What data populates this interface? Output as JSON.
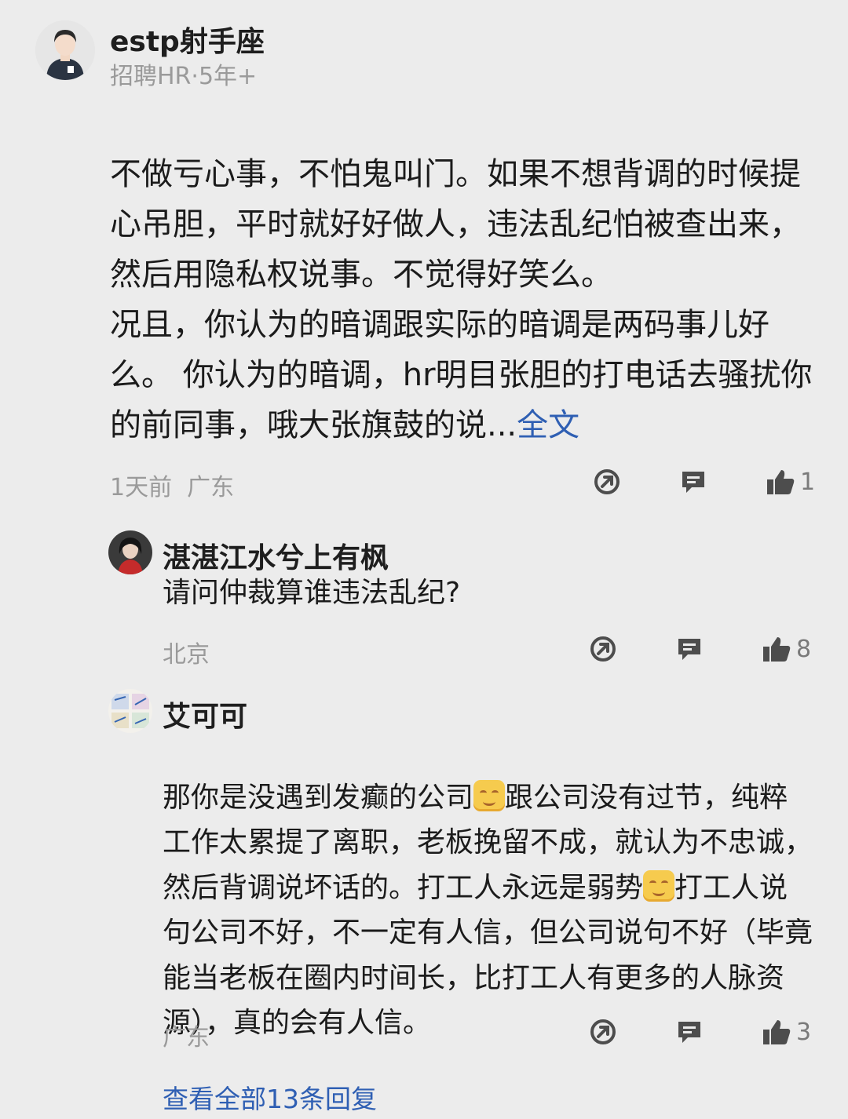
{
  "main_comment": {
    "author": "estp射手座",
    "tag": "招聘HR·5年+",
    "text": "不做亏心事，不怕鬼叫门。如果不想背调的时候提心吊胆，平时就好好做人，违法乱纪怕被查出来，然后用隐私权说事。不觉得好笑么。\n 况且，你认为的暗调跟实际的暗调是两码事儿好么。 你认为的暗调，hr明目张胆的打电话去骚扰你的前同事，哦大张旗鼓的说...",
    "more_label": "全文",
    "time": "1天前",
    "location": "广东",
    "likes": "1",
    "icons": {
      "share": "share-icon",
      "reply": "comment-icon",
      "like": "thumbs-up-icon"
    }
  },
  "replies": [
    {
      "author": "湛湛江水兮上有枫",
      "text": "请问仲裁算谁违法乱纪?",
      "location": "北京",
      "likes": "8"
    },
    {
      "author": "艾可可",
      "text_parts": [
        "那你是没遇到发癫的公司",
        "跟公司没有过节，纯粹工作太累提了离职，老板挽留不成，就认为不忠诚，然后背调说坏话的。打工人永远是弱势",
        "打工人说句公司不好，不一定有人信，但公司说句不好（毕竟能当老板在圈内时间长，比打工人有更多的人脉资源），真的会有人信。"
      ],
      "location": "广东",
      "likes": "3"
    }
  ],
  "view_all_label": "查看全部13条回复",
  "colors": {
    "background": "#ececec",
    "link": "#2f5fb3",
    "meta": "#9a9a9a",
    "icon": "#4d4d4d"
  }
}
